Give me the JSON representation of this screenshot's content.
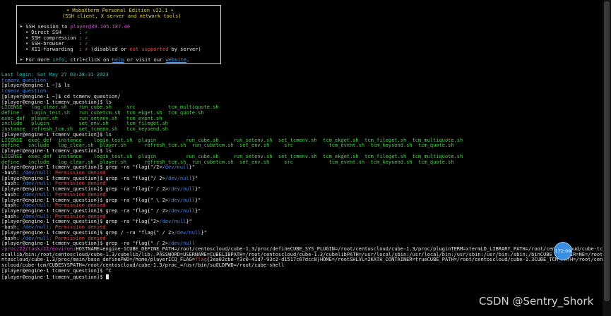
{
  "banner": {
    "title": "• MobaXterm Personal Edition v22.1 •",
    "subtitle": "(SSH client, X server and network tools)",
    "ssh_prefix": "➤ SSH session to ",
    "ssh_target": "player@39.105.187.49",
    "checks": [
      {
        "label": "• Direct SSH      :",
        "mark": "✓",
        "status": "ok"
      },
      {
        "label": "• SSH compression :",
        "mark": "✓",
        "status": "ok"
      },
      {
        "label": "• SSH-browser     :",
        "mark": "✓",
        "status": "ok"
      },
      {
        "label": "• X11-forwarding  :",
        "mark": "✗",
        "status": "bad"
      }
    ],
    "x11_note": {
      "a": " (disabled or ",
      "b": "not supported",
      "c": " by server)"
    },
    "info_prefix": "➤ For more ",
    "info_word": "info",
    "info_mid": ", ctrl+click on ",
    "help_link": "help",
    "info_or": " or visit our ",
    "website_link": "website",
    "info_end": "."
  },
  "terminal": {
    "lines": [
      [
        {
          "t": "Last login: Sat May 27 03:28:31 2023",
          "c": "cyn"
        }
      ],
      [
        {
          "t": "tcmenv_question",
          "c": "blu"
        }
      ],
      [
        {
          "t": "[player@engine-1 ~]$ ls",
          "c": "p"
        }
      ],
      [
        {
          "t": "tcmenv_question",
          "c": "blu"
        }
      ],
      [
        {
          "t": "[player@engine-1 ~]$ cd tcmenv_question/",
          "c": "p"
        }
      ],
      [
        {
          "t": "[player@engine-1 tcmenv_question]$ ls",
          "c": "p"
        }
      ],
      [
        {
          "t": "LICENSE   log_clear.sh    run_cube.sh     src           tcm_multiquote.sh",
          "c": "grn"
        }
      ],
      [
        {
          "t": "define    login_test.sh   run_cubetcm.sh  tcm_ekget.sh  tcm_quote.sh",
          "c": "grn"
        }
      ],
      [
        {
          "t": "exec_def  player.sh       run_setenv.sh   tcm_event.sh",
          "c": "grn"
        }
      ],
      [
        {
          "t": "include   plugin          set_env.sh      tcm_fileget.sh",
          "c": "grn"
        }
      ],
      [
        {
          "t": "instance  refresh_tcm.sh  set_tcmenv.sh   tcm_keysend.sh",
          "c": "grn"
        }
      ],
      [
        {
          "t": "[player@engine-1 tcmenv_question]$ ls",
          "c": "p"
        }
      ],
      [
        {
          "t": "LICENSE  exec_def  instance    login_test.sh  plugin          run_cube.sh     run_setenv.sh  set_tcmenv.sh  tcm_ekget.sh  tcm_fileget.sh  tcm_multiquote.sh",
          "c": "grn"
        }
      ],
      [
        {
          "t": "define   include   log_clear.sh  player.sh      refresh_tcm.sh  run_cubetcm.sh  set_env.sh     src            tcm_event.sh  tcm_keysend.sh  tcm_quote.sh",
          "c": "grn"
        }
      ],
      [
        {
          "t": "[player@engine-1 tcmenv_question]$ ls",
          "c": "p"
        }
      ],
      [
        {
          "t": "LICENSE  exec_def  instance    login_test.sh  plugin          run_cube.sh     run_setenv.sh  set_tcmenv.sh  tcm_ekget.sh  tcm_fileget.sh  tcm_multiquote.sh",
          "c": "grn"
        }
      ],
      [
        {
          "t": "define   include   log_clear.sh  player.sh      refresh_tcm.sh  run_cubetcm.sh  set_env.sh     src            tcm_event.sh  tcm_keysend.sh  tcm_quote.sh",
          "c": "grn"
        }
      ],
      [
        {
          "t": "[player@engine-1 tcmenv_question]$ grep -ra \"flag{\"/2>",
          "c": "p"
        },
        {
          "t": "/dev/null",
          "c": "blu"
        },
        {
          "t": "}\"",
          "c": "p"
        }
      ],
      [
        {
          "t": "-bash: ",
          "c": "p"
        },
        {
          "t": "/dev/null",
          "c": "blu"
        },
        {
          "t": ": Permission denied",
          "c": "red"
        }
      ],
      [
        {
          "t": "[player@engine-1 tcmenv_question]$ grep -ra \"flag{\"/ 2>",
          "c": "p"
        },
        {
          "t": "/dev/null",
          "c": "blu"
        },
        {
          "t": "}\"",
          "c": "p"
        }
      ],
      [
        {
          "t": "-bash: ",
          "c": "p"
        },
        {
          "t": "/dev/null",
          "c": "blu"
        },
        {
          "t": ": Permission denied",
          "c": "red"
        }
      ],
      [
        {
          "t": "[player@engine-1 tcmenv_question]$ grep -ra \"flag{\" / 2>",
          "c": "p"
        },
        {
          "t": "/dev/null",
          "c": "blu"
        },
        {
          "t": "}\"",
          "c": "p"
        }
      ],
      [
        {
          "t": "-bash: ",
          "c": "p"
        },
        {
          "t": "/dev/null",
          "c": "blu"
        },
        {
          "t": ": Permission denied",
          "c": "red"
        }
      ],
      [
        {
          "t": "[player@engine-1 tcmenv_question]$ grep -ra \"flag{\" \\ 2>",
          "c": "p"
        },
        {
          "t": "/dev/null",
          "c": "blu"
        },
        {
          "t": "}\"",
          "c": "p"
        }
      ],
      [
        {
          "t": "-bash: ",
          "c": "p"
        },
        {
          "t": "/dev/null",
          "c": "blu"
        },
        {
          "t": ": Permission denied",
          "c": "red"
        }
      ],
      [
        {
          "t": "[player@engine-1 tcmenv_question]$ grep -ra \"flag{\" / 2>",
          "c": "p"
        },
        {
          "t": "/dev/null",
          "c": "blu"
        },
        {
          "t": "}\"",
          "c": "p"
        }
      ],
      [
        {
          "t": "-bash: ",
          "c": "p"
        },
        {
          "t": "/dev/null",
          "c": "blu"
        },
        {
          "t": ": Permission denied",
          "c": "red"
        }
      ],
      [
        {
          "t": "[player@engine-1 tcmenv_question]$ grep -ra \"flag{\"2>",
          "c": "p"
        },
        {
          "t": "/dev/null",
          "c": "blu"
        },
        {
          "t": "}\"",
          "c": "p"
        }
      ],
      [
        {
          "t": "-bash: ",
          "c": "p"
        },
        {
          "t": "/dev/null",
          "c": "blu"
        },
        {
          "t": ": Permission denied",
          "c": "red"
        }
      ],
      [
        {
          "t": "[player@engine-1 tcmenv_question]$ grep / -ra \"flag{\" / 2>",
          "c": "p"
        },
        {
          "t": "/dev/null",
          "c": "blu"
        },
        {
          "t": "}\"",
          "c": "p"
        }
      ],
      [
        {
          "t": "-bash: ",
          "c": "p"
        },
        {
          "t": "/dev/null",
          "c": "blu"
        },
        {
          "t": ": Permission denied",
          "c": "red"
        }
      ],
      [
        {
          "t": "[player@engine-1 tcmenv_question]$ grep -ra \"flag{\" / 2>",
          "c": "p"
        },
        {
          "t": "/dev/null",
          "c": "blu"
        }
      ],
      [
        {
          "t": "/proc/22/task/22/environ",
          "c": "mag"
        },
        {
          "t": ":HOSTNAME=engine-1CUBE_DEFINE_PATH=/root/centoscloud/cube-1.3/proc/defineCUBE_SYS_PLUGIN=/root/centoscloud/cube-1.3/proc/pluginTERM=xtermLD_LIBRARY_PATH=/root/centoscloud/cube-tcm/l",
          "c": "p"
        }
      ],
      [
        {
          "t": "ocallib/bin:/root/centoscloud/cube-1.3/cubelib/lib:.PASSWORD=USERNAME=CUBELIBPATH=/root/centoscloud/cube-1.3/cubelibPATH=/usr/local/sbin:/usr/local/bin:/usr/sbin:/usr/bin:/sbin:/binCUBE_BASEDIR=NE=/root/ce",
          "c": "p"
        }
      ],
      [
        {
          "t": "ntoscloud/cube-1.3/proc/main/base_definePWD=/home/playerICQ_FLAG=",
          "c": "p"
        },
        {
          "t": "flag",
          "c": "red"
        },
        {
          "t": "{2ea02cbe-f3c0-41d7-93c2-d1517c67dcc8}HOME=/rootSHLVL=2KATA_CONTAINER=trueCUBE_PATH=/root/centoscloud/cube-1.3CUBE_TCM_PATH=/root/cento",
          "c": "p"
        }
      ],
      [
        {
          "t": "scloud/cube-tcm/CUBESYSPATH=/root/centoscloud/cube-1.3/proc_=/usr/bin/suOLDPWD=/root/cube-shell",
          "c": "p"
        }
      ],
      [
        {
          "t": "[player@engine-1 tcmenv_question]$ ^C",
          "c": "p"
        }
      ],
      [
        {
          "t": "[player@engine-1 tcmenv_question]$ ",
          "c": "p"
        }
      ]
    ]
  },
  "badge_text": "172:09",
  "watermark": "CSDN @Sentry_Shork"
}
